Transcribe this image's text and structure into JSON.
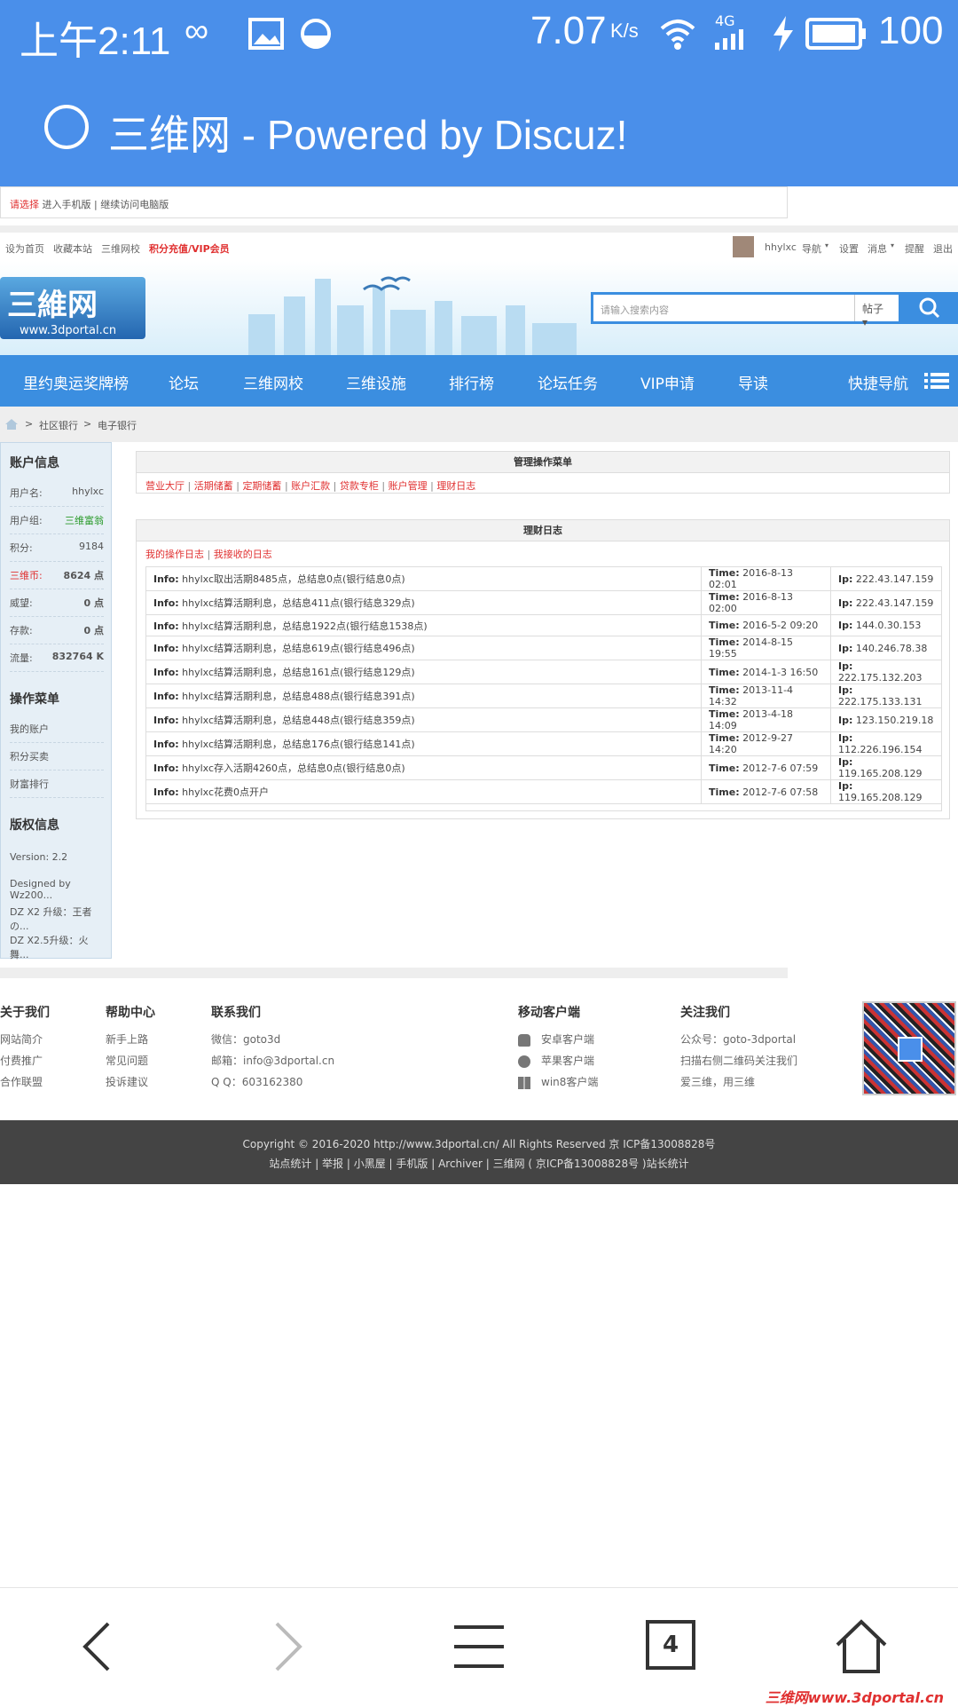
{
  "status": {
    "time": "上午2:11",
    "speed": "7.07",
    "speed_unit": "K/s",
    "network": "4G",
    "battery": "100"
  },
  "browser": {
    "title": "三维网 - Powered by Discuz!"
  },
  "prompt": {
    "choose": "请选择",
    "mobile": "进入手机版",
    "sep": "|",
    "pc": "继续访问电脑版"
  },
  "topnav": {
    "links": [
      "设为首页",
      "收藏本站",
      "三维网校"
    ],
    "vip": "积分充值/VIP会员",
    "user": "hhylxc",
    "right": [
      "导航",
      "设置",
      "消息",
      "提醒",
      "退出"
    ]
  },
  "banner": {
    "logo_main": "三維网",
    "logo_sub": "www.3dportal.cn",
    "search_placeholder": "请输入搜索内容",
    "search_scope": "帖子"
  },
  "mainnav": {
    "items": [
      "里约奥运奖牌榜",
      "论坛",
      "三维网校",
      "三维设施",
      "排行榜",
      "论坛任务",
      "VIP申请",
      "导读"
    ],
    "quick": "快捷导航"
  },
  "breadcrumb": {
    "items": [
      "社区银行",
      "电子银行"
    ],
    "sep": ">"
  },
  "sidebar": {
    "account_title": "账户信息",
    "account_rows": [
      {
        "label": "用户名:",
        "value": "hhylxc"
      },
      {
        "label": "用户组:",
        "value": "三维富翁"
      },
      {
        "label": "积分:",
        "value": "9184"
      },
      {
        "label": "三维币:",
        "value": "8624 点"
      },
      {
        "label": "威望:",
        "value": "0 点"
      },
      {
        "label": "存款:",
        "value": "0 点"
      },
      {
        "label": "流量:",
        "value": "832764 K"
      }
    ],
    "menu_title": "操作菜单",
    "menu_items": [
      "我的账户",
      "积分买卖",
      "财富排行"
    ],
    "copyright_title": "版权信息",
    "copyright_items": [
      "Version: 2.2",
      "Designed by Wz200...",
      "DZ X2 升级：王者の...",
      "DZ X2.5升级：火舞..."
    ]
  },
  "manage": {
    "title": "管理操作菜单",
    "links": [
      "营业大厅",
      "活期储蓄",
      "定期储蓄",
      "账户汇款",
      "贷款专柜",
      "账户管理",
      "理财日志"
    ]
  },
  "log": {
    "title": "理财日志",
    "tabs": [
      "我的操作日志",
      "我接收的日志"
    ],
    "info_label": "Info:",
    "time_label": "Time:",
    "ip_label": "Ip:",
    "rows": [
      {
        "info": "hhylxc取出活期8485点，总结息0点(银行结息0点)",
        "time": "2016-8-13 02:01",
        "ip": "222.43.147.159"
      },
      {
        "info": "hhylxc结算活期利息，总结息411点(银行结息329点)",
        "time": "2016-8-13 02:00",
        "ip": "222.43.147.159"
      },
      {
        "info": "hhylxc结算活期利息，总结息1922点(银行结息1538点)",
        "time": "2016-5-2 09:20",
        "ip": "144.0.30.153"
      },
      {
        "info": "hhylxc结算活期利息，总结息619点(银行结息496点)",
        "time": "2014-8-15 19:55",
        "ip": "140.246.78.38"
      },
      {
        "info": "hhylxc结算活期利息，总结息161点(银行结息129点)",
        "time": "2014-1-3 16:50",
        "ip": "222.175.132.203"
      },
      {
        "info": "hhylxc结算活期利息，总结息488点(银行结息391点)",
        "time": "2013-11-4 14:32",
        "ip": "222.175.133.131"
      },
      {
        "info": "hhylxc结算活期利息，总结息448点(银行结息359点)",
        "time": "2013-4-18 14:09",
        "ip": "123.150.219.18"
      },
      {
        "info": "hhylxc结算活期利息，总结息176点(银行结息141点)",
        "time": "2012-9-27 14:20",
        "ip": "112.226.196.154"
      },
      {
        "info": "hhylxc存入活期4260点，总结息0点(银行结息0点)",
        "time": "2012-7-6 07:59",
        "ip": "119.165.208.129"
      },
      {
        "info": "hhylxc花费0点开户",
        "time": "2012-7-6 07:58",
        "ip": "119.165.208.129"
      }
    ]
  },
  "footer": {
    "about": {
      "title": "关于我们",
      "items": [
        "网站简介",
        "付费推广",
        "合作联盟"
      ]
    },
    "help": {
      "title": "帮助中心",
      "items": [
        "新手上路",
        "常见问题",
        "投诉建议"
      ]
    },
    "contact": {
      "title": "联系我们",
      "items": [
        "微信：goto3d",
        "邮箱：info@3dportal.cn",
        "Q  Q：603162380"
      ]
    },
    "mobile": {
      "title": "移动客户端",
      "items": [
        "安卓客户端",
        "苹果客户端",
        "win8客户端"
      ]
    },
    "follow": {
      "title": "关注我们",
      "items": [
        "公众号：goto-3dportal",
        "扫描右侧二维码关注我们",
        "爱三维，用三维"
      ]
    }
  },
  "copyright": {
    "line1": "Copyright © 2016-2020 http://www.3dportal.cn/ All Rights Reserved 京 ICP备13008828号",
    "line2": "站点统计 | 举报 | 小黑屋 | 手机版 | Archiver | 三维网 ( 京ICP备13008828号 )站长统计"
  },
  "bottombar": {
    "tab_count": "4"
  },
  "watermark": "三维网www.3dportal.cn",
  "colors": {
    "brand_blue": "#4a8fea",
    "nav_blue": "#3b8ee0",
    "link_red": "#e03030"
  }
}
